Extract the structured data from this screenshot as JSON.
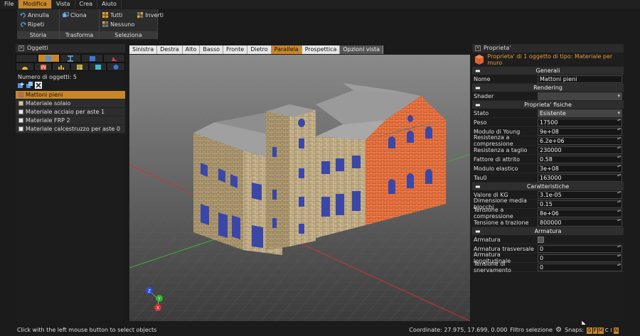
{
  "menu": [
    "File",
    "Modifica",
    "Vista",
    "Crea",
    "Aiuto"
  ],
  "ribbon": {
    "storia": {
      "label": "Storia",
      "undo": "Annulla",
      "redo": "Ripeti"
    },
    "trasforma": {
      "label": "Trasforma",
      "clone": "Clona"
    },
    "seleziona": {
      "label": "Seleziona",
      "all": "Tutti",
      "invert": "Inverti",
      "none": "Nessuno"
    }
  },
  "objects_panel": {
    "title": "Oggetti",
    "count": "Numero di oggetti: 5",
    "items": [
      {
        "label": "Mattoni pieni",
        "color": "#e0652c"
      },
      {
        "label": "Materiale solaio",
        "color": "#d8c89a"
      },
      {
        "label": "Materiale acciaio per aste 1",
        "color": "#e8e8e8"
      },
      {
        "label": "Materiale FRP 2",
        "color": "#e8e8e8"
      },
      {
        "label": "Materiale calcestruzzo per aste 0",
        "color": "#e8e8e8"
      }
    ]
  },
  "view_tabs": [
    "Sinistra",
    "Destra",
    "Alto",
    "Basso",
    "Fronte",
    "Dietro",
    "Parallela",
    "Prospettica",
    "Opzioni vista"
  ],
  "axes": {
    "z": "Z",
    "y": "Y",
    "x": "X"
  },
  "properties": {
    "title": "Proprieta'",
    "header": "Proprieta' di 1 oggetto di tipo: Materiale per muro",
    "sec_generali": "Generali",
    "nome_label": "Nome",
    "nome_value": "Mattoni pieni",
    "sec_rendering": "Rendering",
    "shader_label": "Shader",
    "shader_value": "",
    "sec_fisiche": "Proprieta' fisiche",
    "stato_label": "Stato",
    "stato_value": "Esistente",
    "peso_label": "Peso",
    "peso_value": "17500",
    "young_label": "Modulo di Young",
    "young_value": "9e+08",
    "rescomp_label": "Resistenza a compressione",
    "rescomp_value": "6.2e+06",
    "restaglio_label": "Resistenza a taglio",
    "restaglio_value": "230000",
    "attrito_label": "Fattore di attrito",
    "attrito_value": "0.58",
    "elastico_label": "Modulo elastico",
    "elastico_value": "3e+08",
    "tau_label": "Tau0",
    "tau_value": "163000",
    "sec_caratteristiche": "Caratteristiche",
    "kg_label": "Valore di KG",
    "kg_value": "3.1e-05",
    "dim_label": "Dimensione media blocchi",
    "dim_value": "0.15",
    "tcomp_label": "Tensione a compressione",
    "tcomp_value": "8e+06",
    "ttraz_label": "Tensione a trazione",
    "ttraz_value": "800000",
    "sec_armatura": "Armatura",
    "arm_label": "Armatura",
    "armtr_label": "Armatura trasversale",
    "armtr_value": "0",
    "armlong_label": "Armatura longitudinale",
    "armlong_value": "0",
    "snerv_label": "Tensione di snervamento",
    "snerv_value": "0"
  },
  "status": {
    "hint": "Click with the left mouse button to select objects",
    "coords": "Coordinate: 27.975, 17.699, 0.000",
    "filter": "Filtro selezione",
    "snaps": "Snaps:",
    "snap_letters": [
      "G",
      "P",
      "M",
      "C",
      "I",
      "N"
    ]
  },
  "colors": {
    "accent": "#c9872a",
    "brick": "#d9602e",
    "stone": "#c9b48e",
    "window": "#3a47a8"
  }
}
